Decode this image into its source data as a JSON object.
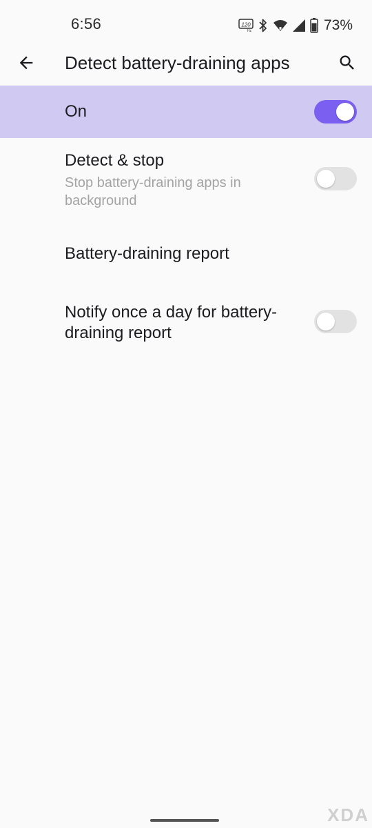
{
  "status_bar": {
    "time": "6:56",
    "battery_percent": "73%",
    "icons": [
      "refresh-rate-120hz-icon",
      "bluetooth-icon",
      "wifi-icon",
      "signal-icon",
      "battery-icon"
    ]
  },
  "app_bar": {
    "title": "Detect battery-draining apps",
    "back_icon": "arrow-back-icon",
    "search_icon": "search-icon"
  },
  "master_switch": {
    "label": "On",
    "checked": true,
    "background_color": "#d0c9f2",
    "accent_color": "#7b5ff0"
  },
  "preferences": [
    {
      "title": "Detect & stop",
      "summary": "Stop battery-draining apps in background",
      "has_toggle": true,
      "checked": false
    },
    {
      "title": "Battery-draining report",
      "has_toggle": false
    },
    {
      "title": "Notify once a day for battery-draining report",
      "has_toggle": true,
      "checked": false
    }
  ],
  "watermark": "XDA"
}
